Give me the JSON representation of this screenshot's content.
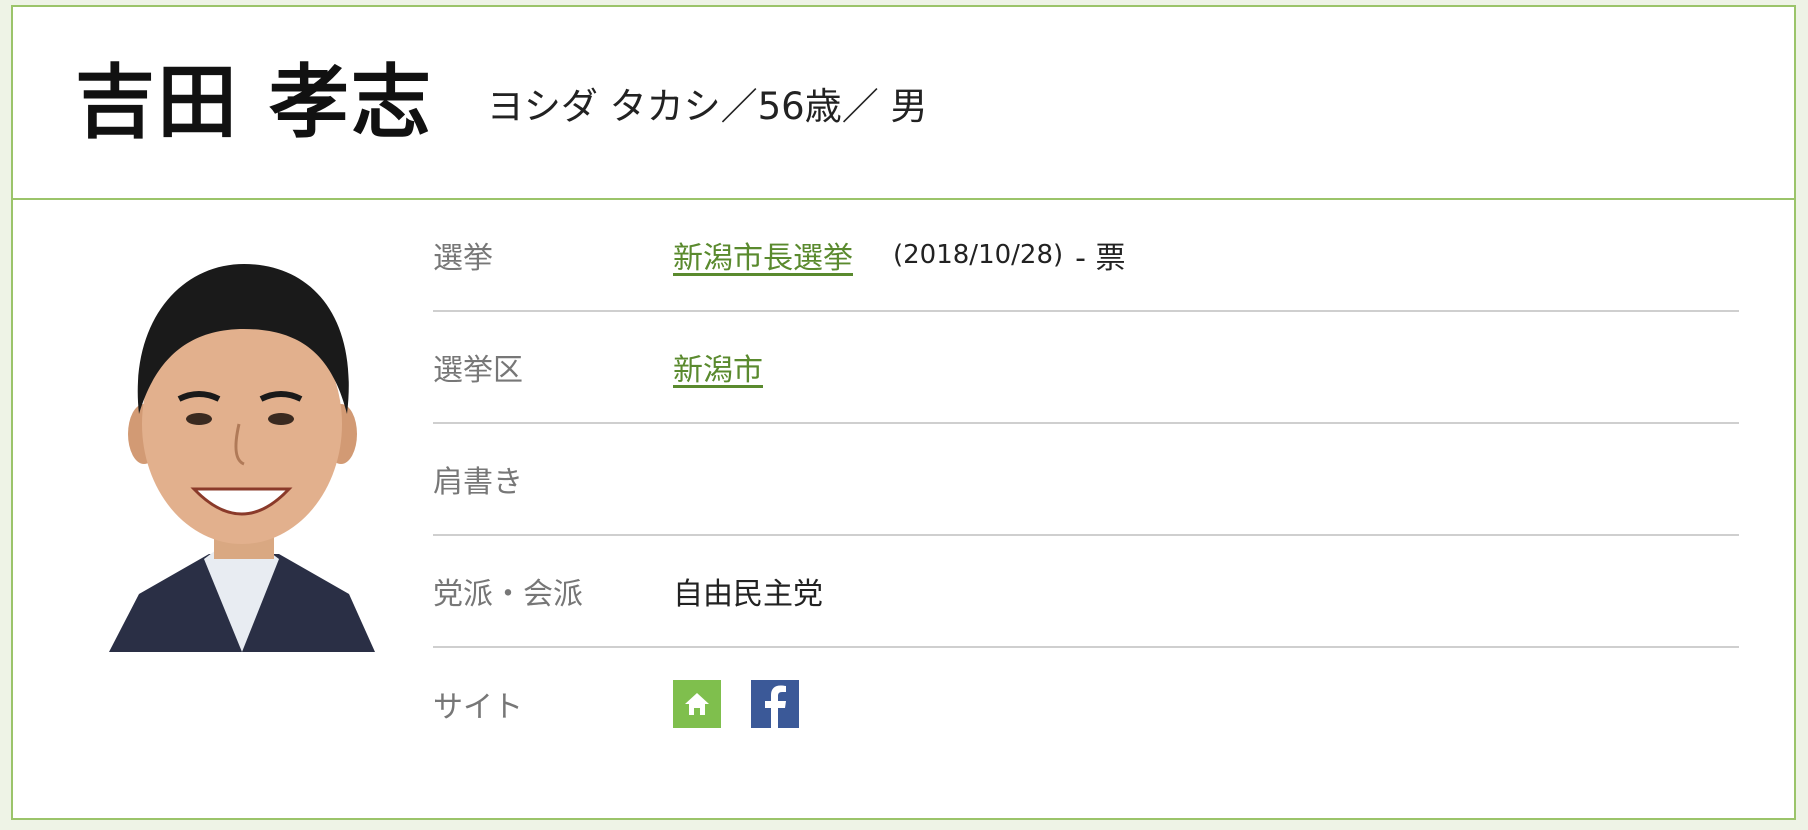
{
  "header": {
    "name": "吉田 孝志",
    "kana": "ヨシダ タカシ",
    "separator": "／",
    "age": "56歳",
    "separator2": "／ ",
    "gender": "男"
  },
  "rows": {
    "election": {
      "label": "選挙",
      "link": "新潟市長選挙",
      "date": "(2018/10/28)",
      "votes": "- 票"
    },
    "district": {
      "label": "選挙区",
      "link": "新潟市"
    },
    "title": {
      "label": "肩書き",
      "value": ""
    },
    "party": {
      "label": "党派・会派",
      "value": "自由民主党"
    },
    "site": {
      "label": "サイト",
      "icons": [
        "home-icon",
        "facebook-icon"
      ]
    }
  },
  "colors": {
    "accent_border": "#9bc46a",
    "link": "#5a8a2e",
    "home_icon_bg": "#7fbf4d",
    "facebook_icon_bg": "#3b5998"
  }
}
